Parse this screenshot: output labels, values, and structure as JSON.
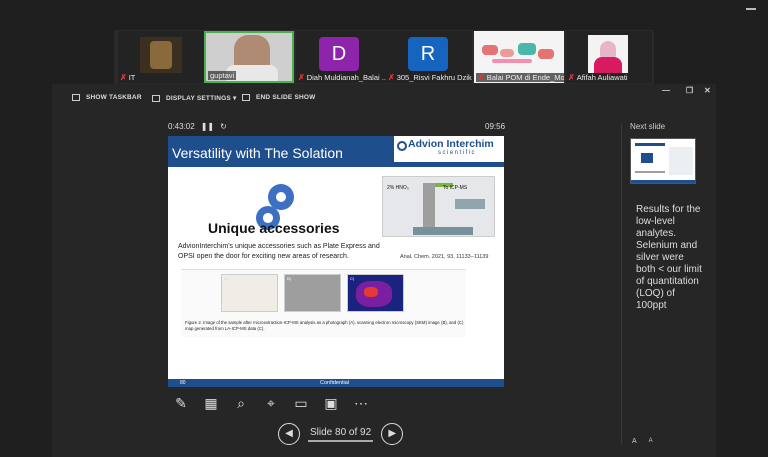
{
  "participants": [
    {
      "name": "IT",
      "muted": true
    },
    {
      "name": "guptavi",
      "muted": false
    },
    {
      "name": "Diah Muldianah_Balai ...",
      "muted": true,
      "initial": "D"
    },
    {
      "name": "305_Risvi Fakhru Dzikr...",
      "muted": true,
      "initial": "R"
    },
    {
      "name": "Balai POM di Ende_Mo...",
      "muted": true
    },
    {
      "name": "Afifah Auliawati",
      "muted": true
    }
  ],
  "toolbar": {
    "show_taskbar": "SHOW TASKBAR",
    "display_settings": "DISPLAY SETTINGS ▾",
    "end_show": "END SLIDE SHOW"
  },
  "presenter": {
    "elapsed": "0:43:02",
    "clock": "09:56",
    "slide_counter": "Slide 80 of 92",
    "next_slide_label": "Next slide",
    "notes": "Results for the low-level analytes. Selenium and silver were both < our limit of quantitation (LOQ) of 100ppt",
    "font_larger": "A",
    "font_smaller": "A"
  },
  "slide": {
    "title": "Versatility with The Solation",
    "brand": "Advion Interchim",
    "brand_sub": "scientific",
    "headline": "Unique accessories",
    "body": "AdvionInterchim's unique accessories such as Plate Express and OPSI open the door for exciting new areas of research.",
    "citation": "Anal. Chem. 2021, 93, 11133−11139",
    "app_label_1": "2% HNO₃",
    "app_label_2": "To ICP-MS",
    "fig_labels": [
      "A)",
      "B)",
      "C)"
    ],
    "fig_caption": "Figure 2. Image of the sample after microextraction-ICP-MS analysis as a photograph (A), scanning electron microscopy (SEM) image (B), and (C) map generated from LA-ICP-MS data (C).",
    "footer_num": "80",
    "footer_conf": "Confidential"
  },
  "colors": {
    "slide_blue": "#1f4e8c",
    "active_tile_border": "#4caf50",
    "avatar_d": "#8e24aa",
    "avatar_r": "#1565c0"
  }
}
